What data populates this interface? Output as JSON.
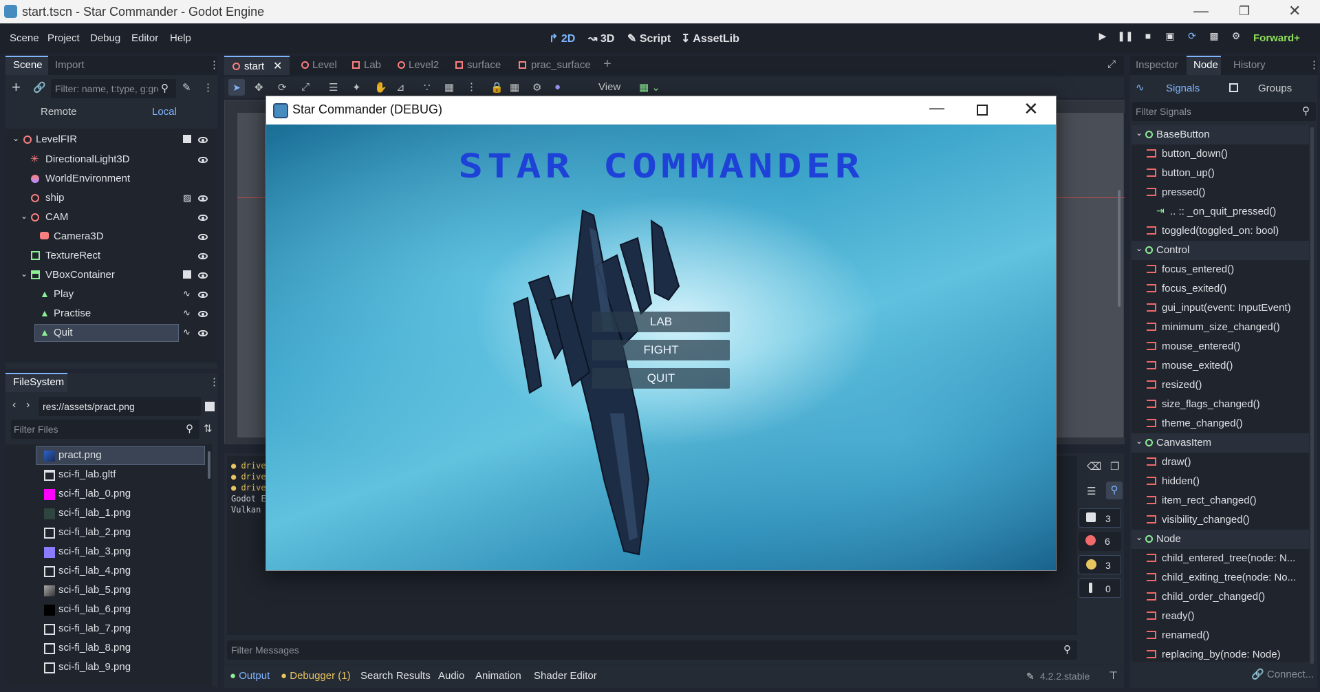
{
  "window": {
    "title": "start.tscn - Star Commander - Godot Engine"
  },
  "menu": {
    "items": [
      "Scene",
      "Project",
      "Debug",
      "Editor",
      "Help"
    ]
  },
  "modes": {
    "d2": "2D",
    "d3": "3D",
    "script": "Script",
    "assetlib": "AssetLib"
  },
  "renderer": "Forward+",
  "scene_dock": {
    "tabs": [
      "Scene",
      "Import"
    ],
    "filter_placeholder": "Filter: name, t:type, g:group",
    "remote": "Remote",
    "local": "Local",
    "tree": [
      {
        "label": "LevelFIR"
      },
      {
        "label": "DirectionalLight3D"
      },
      {
        "label": "WorldEnvironment"
      },
      {
        "label": "ship"
      },
      {
        "label": "CAM"
      },
      {
        "label": "Camera3D"
      },
      {
        "label": "TextureRect"
      },
      {
        "label": "VBoxContainer"
      },
      {
        "label": "Play"
      },
      {
        "label": "Practise"
      },
      {
        "label": "Quit"
      }
    ]
  },
  "filesystem": {
    "title": "FileSystem",
    "path": "res://assets/pract.png",
    "filter_placeholder": "Filter Files",
    "files": [
      "pract.png",
      "sci-fi_lab.gltf",
      "sci-fi_lab_0.png",
      "sci-fi_lab_1.png",
      "sci-fi_lab_2.png",
      "sci-fi_lab_3.png",
      "sci-fi_lab_4.png",
      "sci-fi_lab_5.png",
      "sci-fi_lab_6.png",
      "sci-fi_lab_7.png",
      "sci-fi_lab_8.png",
      "sci-fi_lab_9.png"
    ]
  },
  "scene_tabs": [
    "start",
    "Level",
    "Lab",
    "Level2",
    "surface",
    "prac_surface"
  ],
  "toolbar": {
    "view": "View"
  },
  "game": {
    "title": "Star Commander (DEBUG)",
    "heading": "STAR COMMANDER",
    "buttons": [
      "LAB",
      "FIGHT",
      "QUIT"
    ]
  },
  "output": {
    "lines": [
      "drive",
      "drive",
      "drive",
      "Godot E",
      "Vulkan"
    ],
    "filter_placeholder": "Filter Messages",
    "counts": [
      "3",
      "6",
      "3",
      "0"
    ]
  },
  "bottom_tabs": {
    "output": "Output",
    "debugger": "Debugger (1)",
    "search": "Search Results",
    "audio": "Audio",
    "animation": "Animation",
    "shader": "Shader Editor"
  },
  "version": "4.2.2.stable",
  "right_dock": {
    "tabs": [
      "Inspector",
      "Node",
      "History"
    ],
    "signals": "Signals",
    "groups": "Groups",
    "filter_placeholder": "Filter Signals",
    "connect": "Connect...",
    "rows": [
      {
        "label": "BaseButton",
        "group": true
      },
      {
        "label": "button_down()"
      },
      {
        "label": "button_up()"
      },
      {
        "label": "pressed()"
      },
      {
        "label": ".. :: _on_quit_pressed()",
        "conn": true
      },
      {
        "label": "toggled(toggled_on: bool)"
      },
      {
        "label": "Control",
        "group": true
      },
      {
        "label": "focus_entered()"
      },
      {
        "label": "focus_exited()"
      },
      {
        "label": "gui_input(event: InputEvent)"
      },
      {
        "label": "minimum_size_changed()"
      },
      {
        "label": "mouse_entered()"
      },
      {
        "label": "mouse_exited()"
      },
      {
        "label": "resized()"
      },
      {
        "label": "size_flags_changed()"
      },
      {
        "label": "theme_changed()"
      },
      {
        "label": "CanvasItem",
        "group": true
      },
      {
        "label": "draw()"
      },
      {
        "label": "hidden()"
      },
      {
        "label": "item_rect_changed()"
      },
      {
        "label": "visibility_changed()"
      },
      {
        "label": "Node",
        "group": true
      },
      {
        "label": "child_entered_tree(node: N..."
      },
      {
        "label": "child_exiting_tree(node: No..."
      },
      {
        "label": "child_order_changed()"
      },
      {
        "label": "ready()"
      },
      {
        "label": "renamed()"
      },
      {
        "label": "replacing_by(node: Node)"
      }
    ]
  }
}
